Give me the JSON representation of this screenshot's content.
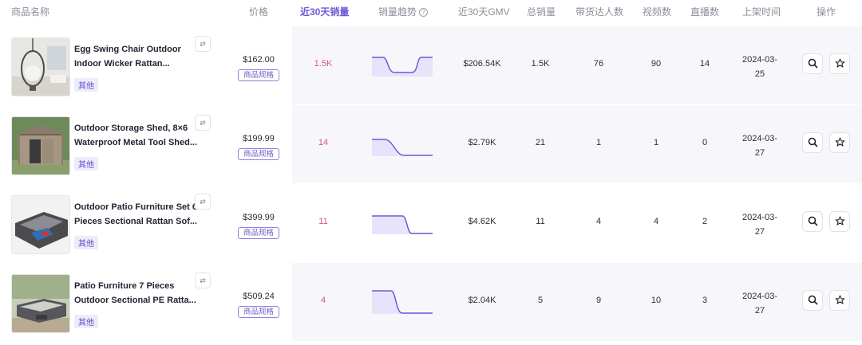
{
  "headers": {
    "product": "商品名称",
    "price": "价格",
    "sales30": "近30天销量",
    "trend": "销量趋势",
    "gmv30": "近30天GMV",
    "total_sales": "总销量",
    "creators": "带货达人数",
    "videos": "视频数",
    "lives": "直播数",
    "listed": "上架时间",
    "actions": "操作"
  },
  "spec_label": "商品规格",
  "rows": [
    {
      "title_line1": "Egg Swing Chair Outdoor",
      "title_line2": "Indoor Wicker Rattan...",
      "category": "其他",
      "price": "$162.00",
      "sales30": "1.5K",
      "trend": "low-then-high",
      "gmv": "$206.54K",
      "total": "1.5K",
      "creators": "76",
      "videos": "90",
      "lives": "14",
      "date_line1": "2024-03-",
      "date_line2": "25"
    },
    {
      "title_line1": "Outdoor Storage Shed, 8×6",
      "title_line2": "Waterproof Metal Tool Shed...",
      "category": "其他",
      "price": "$199.99",
      "sales30": "14",
      "trend": "high-then-low-gradual",
      "gmv": "$2.79K",
      "total": "21",
      "creators": "1",
      "videos": "1",
      "lives": "0",
      "date_line1": "2024-03-",
      "date_line2": "27"
    },
    {
      "title_line1": "Outdoor Patio Furniture Set 6",
      "title_line2": "Pieces Sectional Rattan Sof...",
      "category": "其他",
      "price": "$399.99",
      "sales30": "11",
      "trend": "high-then-low",
      "gmv": "$4.62K",
      "total": "11",
      "creators": "4",
      "videos": "4",
      "lives": "2",
      "date_line1": "2024-03-",
      "date_line2": "27"
    },
    {
      "title_line1": "Patio Furniture 7 Pieces",
      "title_line2": "Outdoor Sectional PE Ratta...",
      "category": "其他",
      "price": "$509.24",
      "sales30": "4",
      "trend": "high-then-low",
      "gmv": "$2.04K",
      "total": "5",
      "creators": "9",
      "videos": "10",
      "lives": "3",
      "date_line1": "2024-03-",
      "date_line2": "27"
    }
  ],
  "colors": {
    "accent": "#6b5bd6",
    "sales_pink": "#d5577e",
    "row_shade": "#f7f7fb"
  },
  "icons": {
    "translate": "translate-icon",
    "search": "search-icon",
    "star": "star-icon",
    "help": "help-icon"
  }
}
